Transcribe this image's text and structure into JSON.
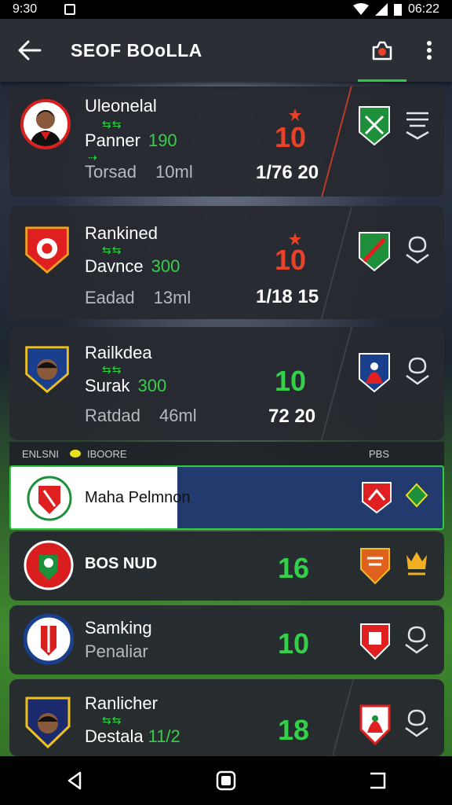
{
  "status_bar": {
    "time_left": "9:30",
    "time_right": "06:22"
  },
  "app_bar": {
    "title": "SEOF BOoLLA"
  },
  "cards": [
    {
      "name": "Uleonelal",
      "line2_label": "Panner",
      "line2_value": "190",
      "line3_label": "Torsad",
      "line3_value": "10ml",
      "big_number": "10",
      "score": "1/76 20"
    },
    {
      "name": "Rankined",
      "line2_label": "Davnce",
      "line2_value": "300",
      "line3_label": "Eadad",
      "line3_value": "13ml",
      "big_number": "10",
      "score": "1/18 15"
    },
    {
      "name": "Railkdea",
      "line2_label": "Surak",
      "line2_value": "300",
      "line3_label": "Ratdad",
      "line3_value": "46ml",
      "big_number": "10",
      "score": "72 20"
    }
  ],
  "section_header": {
    "left": "ENLSNI",
    "middle": "IBOORE",
    "right": "PBS"
  },
  "highlight_row": {
    "name": "Maha Pelmnon"
  },
  "teams": [
    {
      "name": "BOS NUD",
      "sub": "",
      "number": "16"
    },
    {
      "name": "Samking",
      "sub": "Penaliar",
      "number": "10"
    },
    {
      "name": "Ranlicher",
      "sub": "Destala",
      "sub_value": "11/2",
      "number": "18"
    }
  ],
  "colors": {
    "accent_green": "#35d04a",
    "accent_red": "#e8432a",
    "accent_orange": "#f0a020",
    "card_bg": "#262a30",
    "app_bar": "#2b2f35"
  },
  "icons": {
    "back": "arrow-left-icon",
    "camera": "camera-icon",
    "more": "more-vert-icon"
  }
}
